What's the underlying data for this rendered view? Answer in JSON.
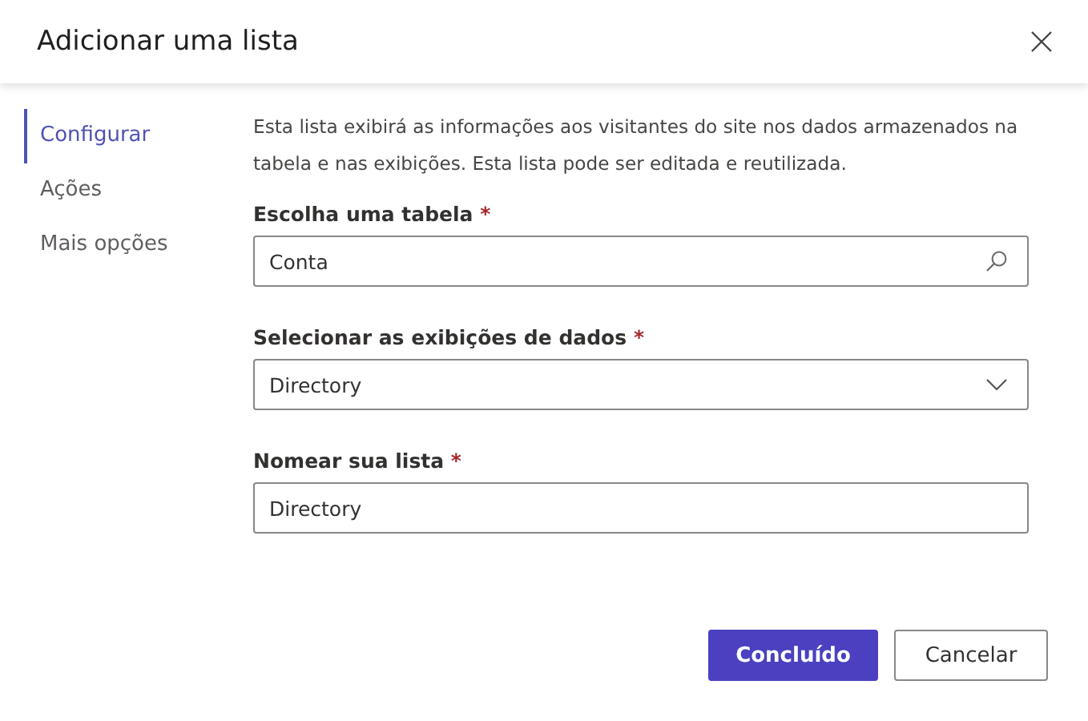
{
  "dialog": {
    "title": "Adicionar uma lista"
  },
  "nav": [
    {
      "label": "Configurar",
      "selected": true
    },
    {
      "label": "Ações",
      "selected": false
    },
    {
      "label": "Mais opções",
      "selected": false
    }
  ],
  "description": "Esta lista exibirá as informações aos visitantes do site nos dados armazenados na tabela e nas exibições. Esta lista pode ser editada e reutilizada.",
  "fields": [
    {
      "label": "Escolha uma tabela",
      "required": "*",
      "kind": "search",
      "value": "Conta"
    },
    {
      "label": "Selecionar as exibições de dados",
      "required": "*",
      "kind": "dropdown",
      "value": "Directory"
    },
    {
      "label": "Nomear sua lista",
      "required": "*",
      "kind": "text",
      "value": "Directory"
    }
  ],
  "buttons": [
    {
      "label": "Concluído",
      "kind": "primary"
    },
    {
      "label": "Cancelar",
      "kind": "secondary"
    }
  ]
}
